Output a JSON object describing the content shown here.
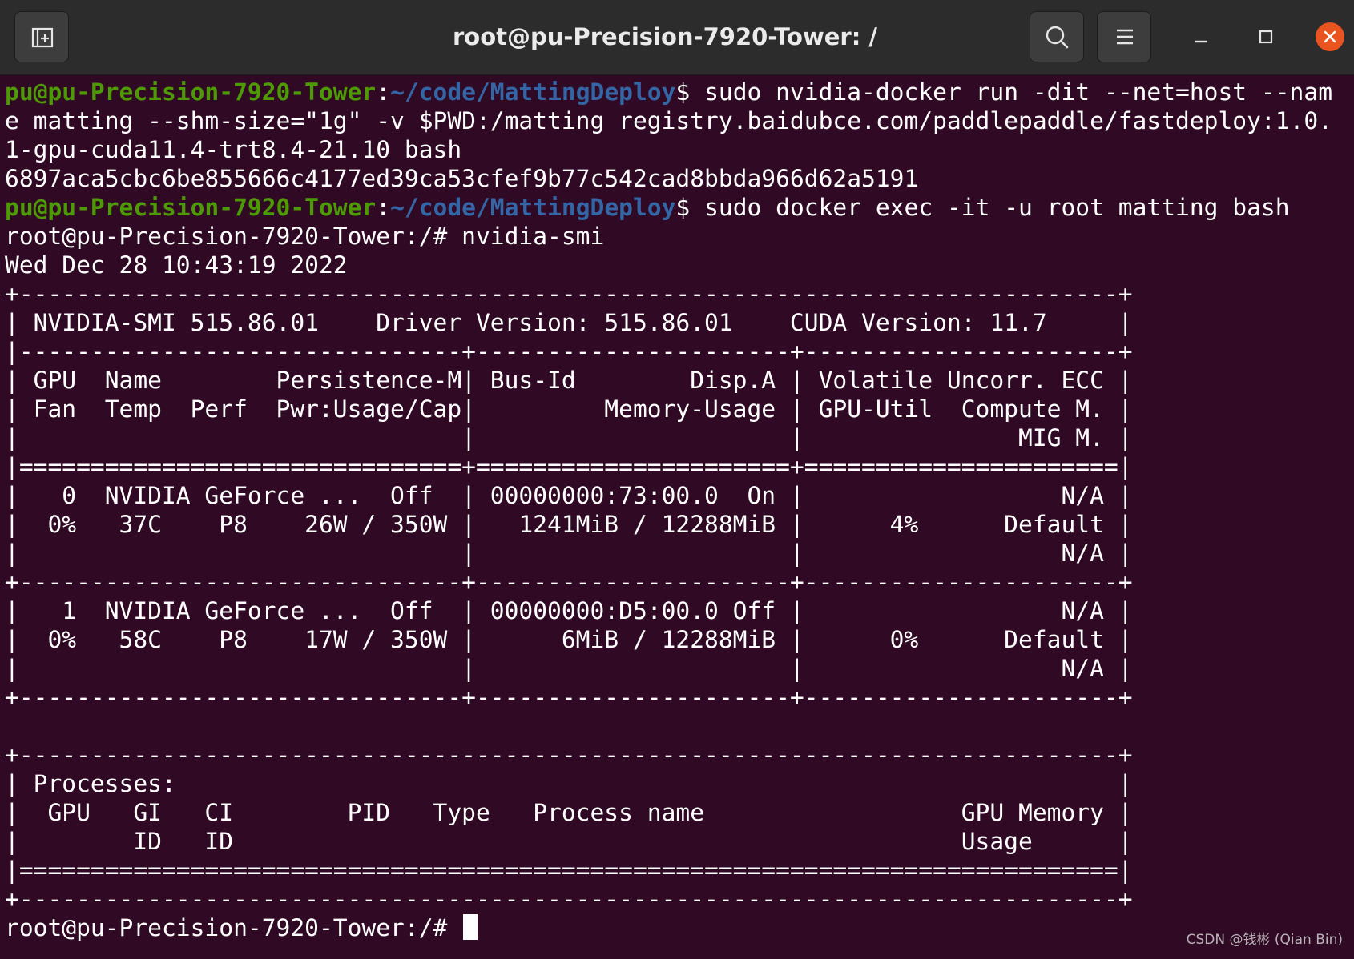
{
  "window": {
    "title": "root@pu-Precision-7920-Tower: /",
    "buttons": {
      "new_tab_icon": "new-tab-icon",
      "search_icon": "search-icon",
      "menu_icon": "hamburger-menu-icon",
      "minimize_icon": "minimize-icon",
      "maximize_icon": "maximize-icon",
      "close_icon": "close-icon"
    }
  },
  "colors": {
    "background": "#300a24",
    "prompt_host": "#4e9a06",
    "prompt_path": "#3465a4",
    "text": "#ffffff",
    "close_button": "#e95420"
  },
  "terminal": {
    "prompt1": {
      "user_host": "pu@pu-Precision-7920-Tower",
      "sep": ":",
      "path": "~/code/MattingDeploy",
      "symbol": "$",
      "command": " sudo nvidia-docker run -dit --net=host --nam"
    },
    "wrap1": "e matting --shm-size=\"1g\" -v $PWD:/matting registry.baidubce.com/paddlepaddle/fastdeploy:1.0.",
    "wrap2": "1-gpu-cuda11.4-trt8.4-21.10 bash",
    "container_id": "6897aca5cbc6be855666c4177ed39ca53cfef9b77c542cad8bbda966d62a5191",
    "prompt2": {
      "user_host": "pu@pu-Precision-7920-Tower",
      "sep": ":",
      "path": "~/code/MattingDeploy",
      "symbol": "$",
      "command": " sudo docker exec -it -u root matting bash"
    },
    "root_cmd": "root@pu-Precision-7920-Tower:/# nvidia-smi",
    "date": "Wed Dec 28 10:43:19 2022",
    "smi": [
      "+-----------------------------------------------------------------------------+",
      "| NVIDIA-SMI 515.86.01    Driver Version: 515.86.01    CUDA Version: 11.7     |",
      "|-------------------------------+----------------------+----------------------+",
      "| GPU  Name        Persistence-M| Bus-Id        Disp.A | Volatile Uncorr. ECC |",
      "| Fan  Temp  Perf  Pwr:Usage/Cap|         Memory-Usage | GPU-Util  Compute M. |",
      "|                               |                      |               MIG M. |",
      "|===============================+======================+======================|",
      "|   0  NVIDIA GeForce ...  Off  | 00000000:73:00.0  On |                  N/A |",
      "|  0%   37C    P8    26W / 350W |   1241MiB / 12288MiB |      4%      Default |",
      "|                               |                      |                  N/A |",
      "+-------------------------------+----------------------+----------------------+",
      "|   1  NVIDIA GeForce ...  Off  | 00000000:D5:00.0 Off |                  N/A |",
      "|  0%   58C    P8    17W / 350W |      6MiB / 12288MiB |      0%      Default |",
      "|                               |                      |                  N/A |",
      "+-------------------------------+----------------------+----------------------+",
      "",
      "+-----------------------------------------------------------------------------+",
      "| Processes:                                                                  |",
      "|  GPU   GI   CI        PID   Type   Process name                  GPU Memory |",
      "|        ID   ID                                                   Usage      |",
      "|=============================================================================|",
      "+-----------------------------------------------------------------------------+"
    ],
    "final_prompt": "root@pu-Precision-7920-Tower:/# "
  },
  "watermark": "CSDN @钱彬 (Qian Bin)"
}
